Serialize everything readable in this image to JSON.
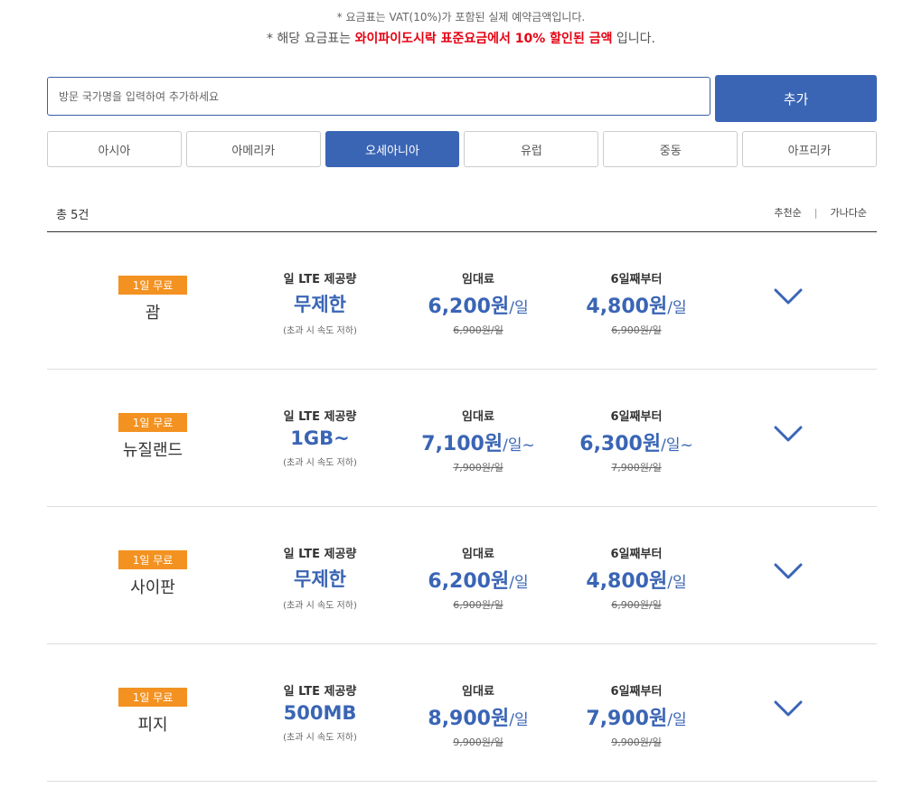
{
  "notice": {
    "line1": "* 요금표는 VAT(10%)가 포함된 실제 예약금액입니다.",
    "line2_before": "* 해당 요금표는 ",
    "line2_highlight": "와이파이도시락 표준요금에서 10% 할인된 금액",
    "line2_after": " 입니다."
  },
  "search": {
    "placeholder": "방문 국가명을 입력하여 추가하세요",
    "add_label": "추가"
  },
  "tabs": [
    "아시아",
    "아메리카",
    "오세아니아",
    "유럽",
    "중동",
    "아프리카"
  ],
  "active_tab": "오세아니아",
  "list_header": {
    "total": "총 5건",
    "sort_recommend": "추천순",
    "sort_separator": "|",
    "sort_alpha": "가나다순"
  },
  "colors": {
    "accent": "#3a65b5",
    "badge": "#f39221",
    "highlight": "#e60012"
  },
  "items": [
    {
      "badge": "1일 무료",
      "country": "괌",
      "data_label": "일 LTE 제공량",
      "data_amount": "무제한",
      "data_note": "(초과 시 속도 저하)",
      "rent_label": "임대료",
      "rent_price": "6,200원",
      "rent_unit": "/일",
      "rent_original": "6,900원/일",
      "day6_label": "6일째부터",
      "day6_price": "4,800원",
      "day6_unit": "/일",
      "day6_original": "6,900원/일",
      "toggle_icon": "chevron-down-icon"
    },
    {
      "badge": "1일 무료",
      "country": "뉴질랜드",
      "data_label": "일 LTE 제공량",
      "data_amount": "1GB~",
      "data_note": "(초과 시 속도 저하)",
      "rent_label": "임대료",
      "rent_price": "7,100원",
      "rent_unit": "/일~",
      "rent_original": "7,900원/일",
      "day6_label": "6일째부터",
      "day6_price": "6,300원",
      "day6_unit": "/일~",
      "day6_original": "7,900원/일",
      "toggle_icon": "chevron-down-icon"
    },
    {
      "badge": "1일 무료",
      "country": "사이판",
      "data_label": "일 LTE 제공량",
      "data_amount": "무제한",
      "data_note": "(초과 시 속도 저하)",
      "rent_label": "임대료",
      "rent_price": "6,200원",
      "rent_unit": "/일",
      "rent_original": "6,900원/일",
      "day6_label": "6일째부터",
      "day6_price": "4,800원",
      "day6_unit": "/일",
      "day6_original": "6,900원/일",
      "toggle_icon": "chevron-down-icon"
    },
    {
      "badge": "1일 무료",
      "country": "피지",
      "data_label": "일 LTE 제공량",
      "data_amount": "500MB",
      "data_note": "(초과 시 속도 저하)",
      "rent_label": "임대료",
      "rent_price": "8,900원",
      "rent_unit": "/일",
      "rent_original": "9,900원/일",
      "day6_label": "6일째부터",
      "day6_price": "7,900원",
      "day6_unit": "/일",
      "day6_original": "9,900원/일",
      "toggle_icon": "chevron-down-icon"
    }
  ]
}
